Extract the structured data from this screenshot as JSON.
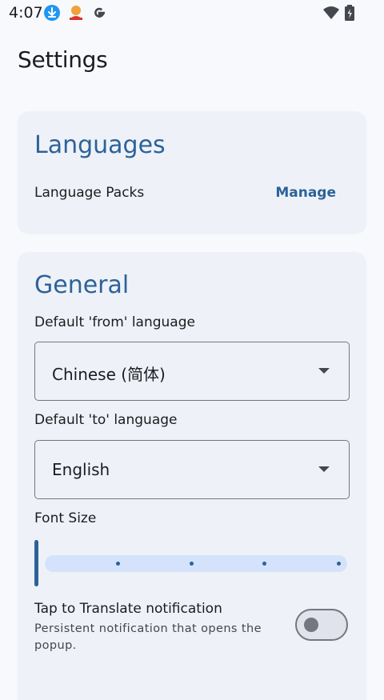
{
  "status_bar": {
    "time": "4:07",
    "icons": [
      "download-icon",
      "app-notification-icon",
      "google-icon"
    ],
    "right_icons": [
      "wifi-icon",
      "battery-icon"
    ]
  },
  "page": {
    "title": "Settings"
  },
  "languages_card": {
    "title": "Languages",
    "row_label": "Language Packs",
    "action_label": "Manage"
  },
  "general_card": {
    "title": "General",
    "from_label": "Default 'from' language",
    "from_value": "Chinese (简体)",
    "to_label": "Default 'to' language",
    "to_value": "English",
    "font_size_label": "Font Size",
    "font_size_level": 0,
    "font_size_steps": 5,
    "toggle_title": "Tap to Translate notification",
    "toggle_description": "Persistent notification that opens the popup.",
    "toggle_on": false
  },
  "colors": {
    "accent": "#2d6299",
    "card_bg": "#eef2f8",
    "page_bg": "#f7f9fd",
    "track": "#d4e3fb"
  }
}
